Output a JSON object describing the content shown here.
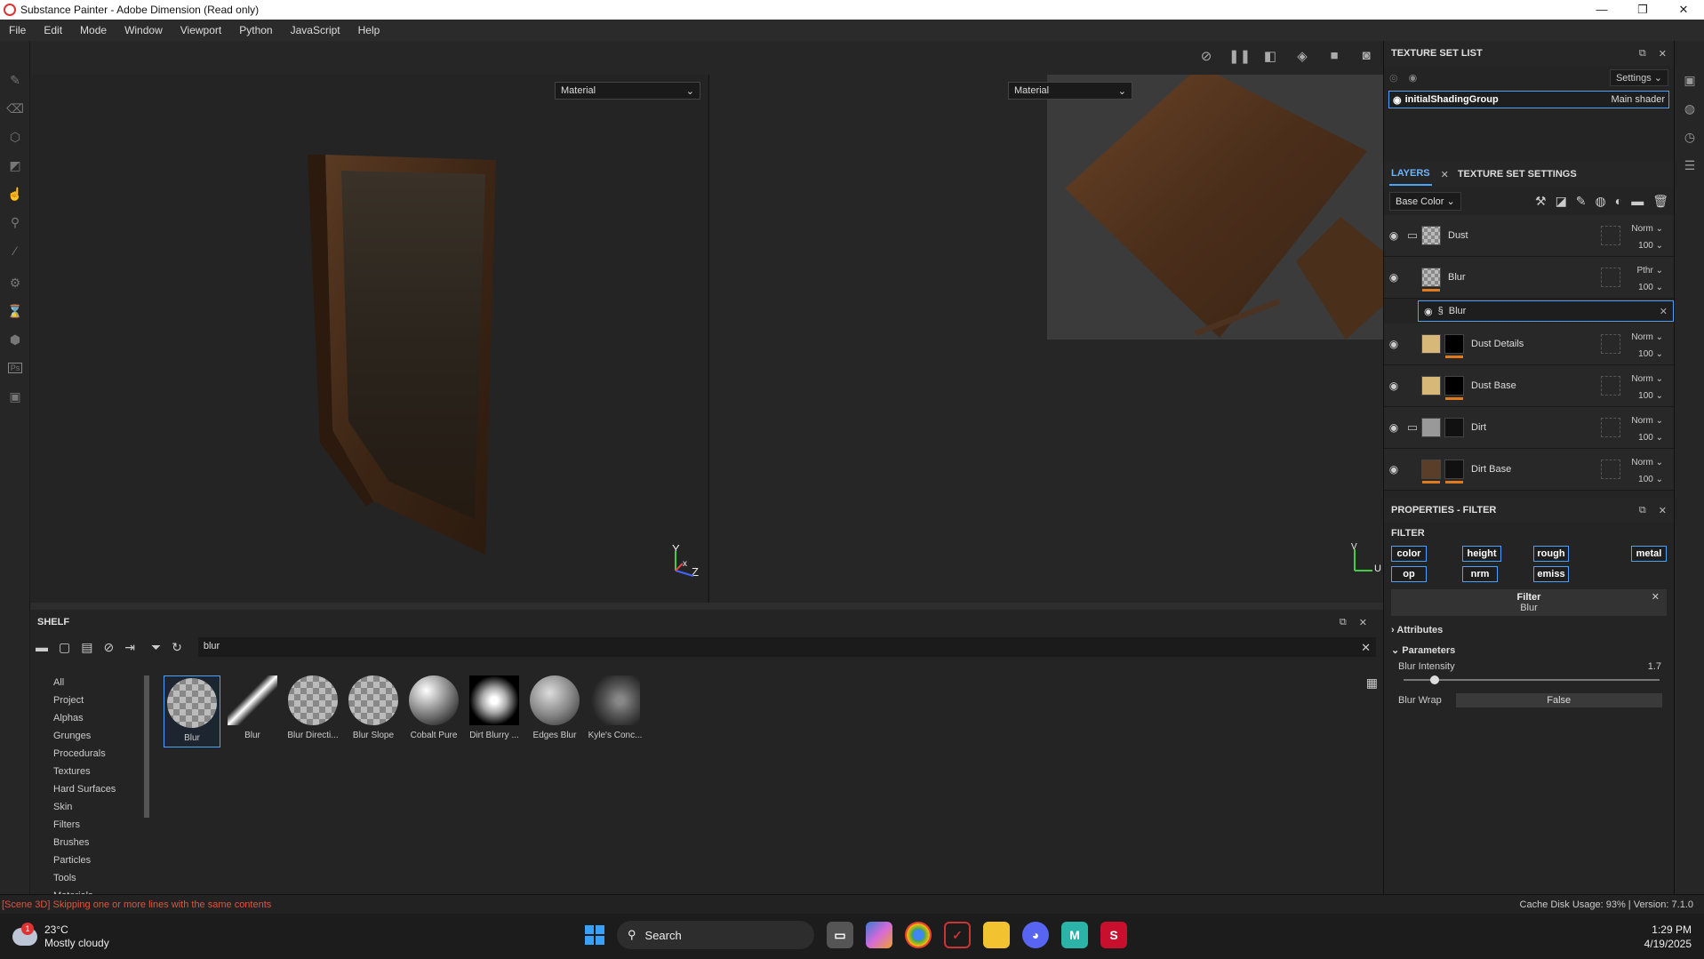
{
  "window": {
    "title": "Substance Painter - Adobe Dimension (Read only)",
    "controls": [
      "—",
      "❐",
      "✕"
    ]
  },
  "menu": [
    "File",
    "Edit",
    "Mode",
    "Window",
    "Viewport",
    "Python",
    "JavaScript",
    "Help"
  ],
  "viewport": {
    "left_mode": "Material",
    "right_mode": "Material",
    "axes_3d": {
      "y": "Y",
      "x": "x",
      "z": "Z"
    },
    "axes_2d": {
      "v": "V",
      "u": "U"
    }
  },
  "texture_set_list": {
    "title": "TEXTURE SET LIST",
    "settings_label": "Settings",
    "item_name": "initialShadingGroup",
    "item_shader": "Main shader"
  },
  "layers": {
    "tab_layers": "LAYERS",
    "tab_settings": "TEXTURE SET SETTINGS",
    "channel": "Base Color",
    "rows": [
      {
        "name": "Dust",
        "mode": "Norm",
        "opacity": "100"
      },
      {
        "name": "Blur",
        "mode": "Pthr",
        "opacity": "100"
      },
      {
        "name": "Dust Details",
        "mode": "Norm",
        "opacity": "100"
      },
      {
        "name": "Dust Base",
        "mode": "Norm",
        "opacity": "100"
      },
      {
        "name": "Dirt",
        "mode": "Norm",
        "opacity": "100"
      },
      {
        "name": "Dirt Base",
        "mode": "Norm",
        "opacity": "100"
      }
    ],
    "sub_filter": "Blur"
  },
  "properties": {
    "title": "PROPERTIES - FILTER",
    "section": "FILTER",
    "channels": [
      "color",
      "height",
      "rough",
      "metal",
      "op",
      "nrm",
      "emiss"
    ],
    "filter_label": "Filter",
    "filter_value": "Blur",
    "attributes": "Attributes",
    "parameters": "Parameters",
    "blur_intensity_label": "Blur Intensity",
    "blur_intensity_value": "1.7",
    "blur_intensity_fraction": 0.12,
    "blur_wrap_label": "Blur Wrap",
    "blur_wrap_value": "False"
  },
  "shelf": {
    "title": "SHELF",
    "search": "blur",
    "categories": [
      "All",
      "Project",
      "Alphas",
      "Grunges",
      "Procedurals",
      "Textures",
      "Hard Surfaces",
      "Skin",
      "Filters",
      "Brushes",
      "Particles",
      "Tools",
      "Materials"
    ],
    "items": [
      "Blur",
      "Blur",
      "Blur Directi...",
      "Blur Slope",
      "Cobalt Pure",
      "Dirt Blurry ...",
      "Edges Blur",
      "Kyle's Conc..."
    ]
  },
  "status": {
    "message": "[Scene 3D] Skipping one or more lines with the same contents",
    "cache": "Cache Disk Usage:   93% | Version: 7.1.0"
  },
  "taskbar": {
    "temp": "23°C",
    "weather": "Mostly cloudy",
    "badge": "1",
    "search": "Search",
    "time": "1:29 PM",
    "date": "4/19/2025"
  }
}
